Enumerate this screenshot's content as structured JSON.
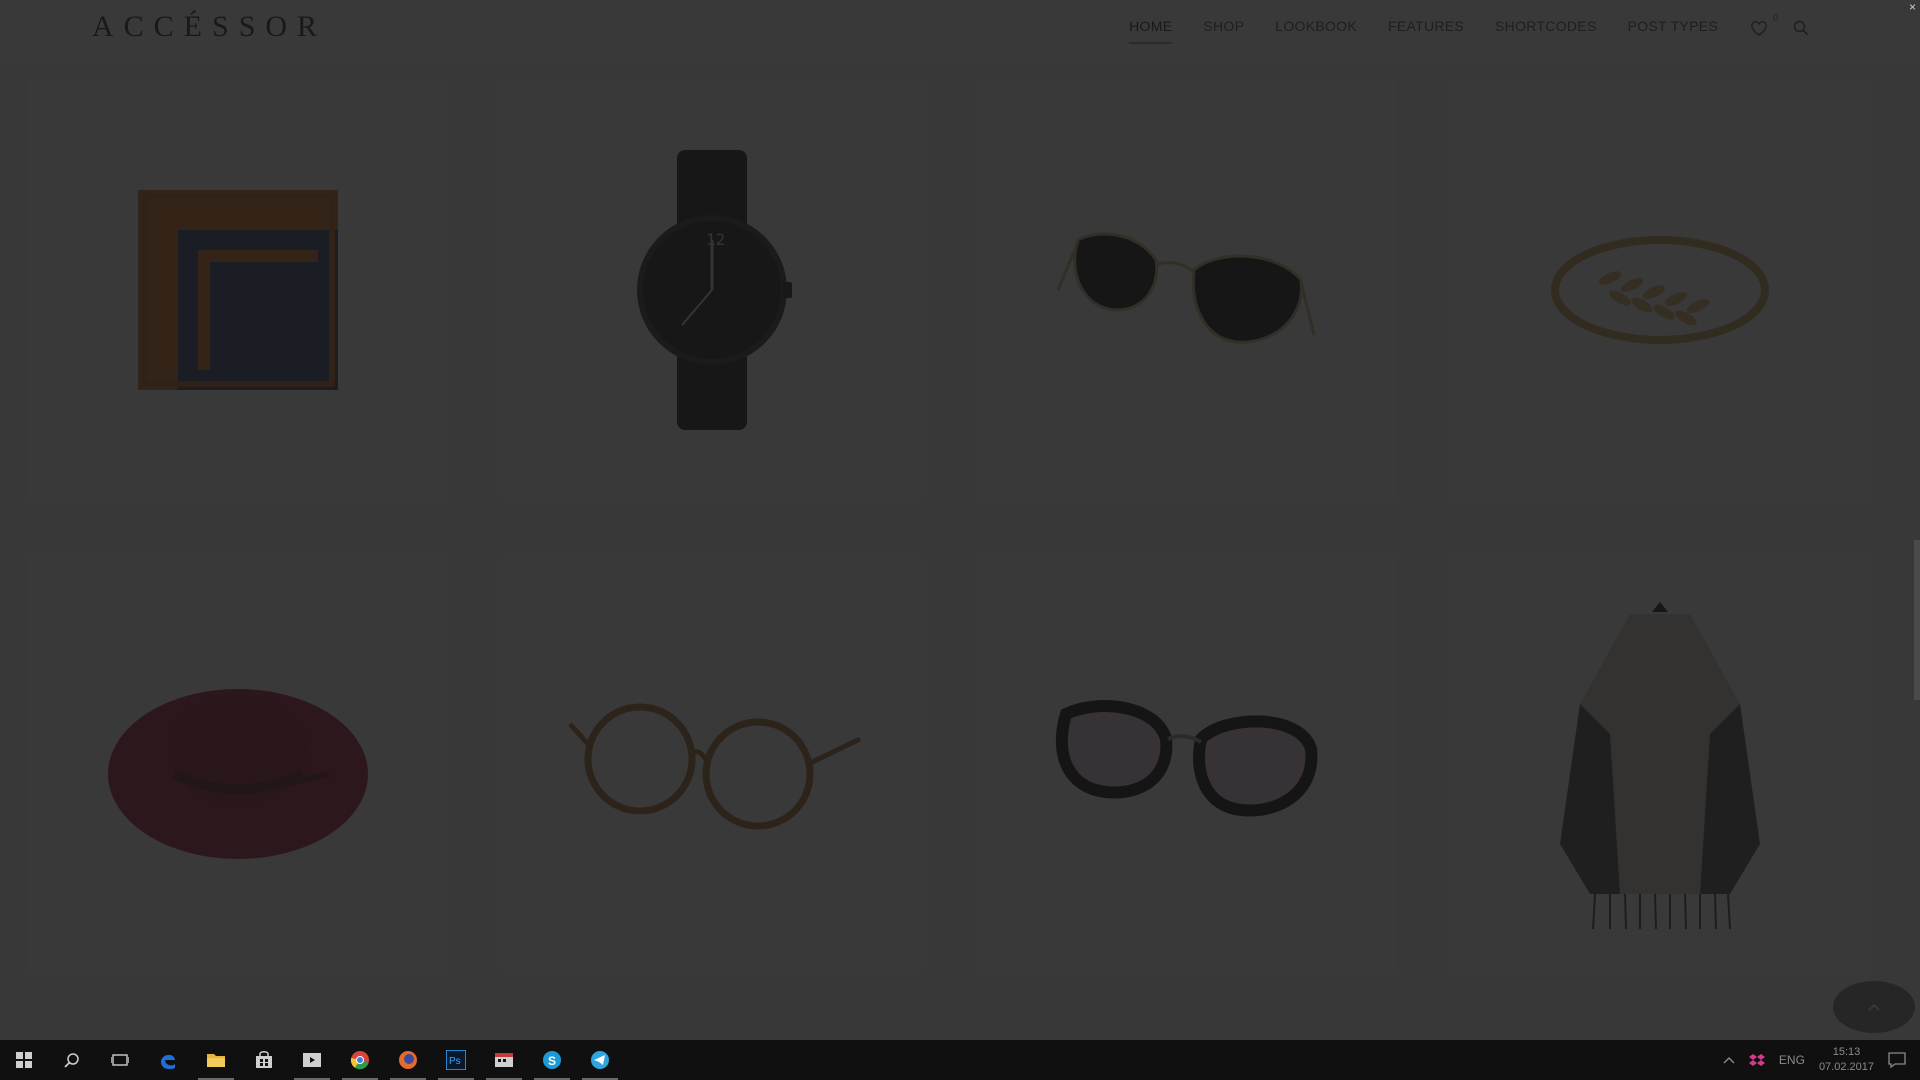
{
  "site": {
    "logo": "ACCÉSSOR",
    "nav": [
      {
        "label": "HOME",
        "active": true
      },
      {
        "label": "SHOP",
        "active": false
      },
      {
        "label": "LOOKBOOK",
        "active": false
      },
      {
        "label": "FEATURES",
        "active": false
      },
      {
        "label": "SHORTCODES",
        "active": false
      },
      {
        "label": "POST TYPES",
        "active": false
      }
    ],
    "wishlist_count": "0",
    "icons": [
      "heart-icon",
      "search-icon"
    ]
  },
  "products": [
    {
      "name": "pocket-square",
      "icon": "scarf-image"
    },
    {
      "name": "watch",
      "icon": "watch-image"
    },
    {
      "name": "cat-eye-sunglasses",
      "icon": "sunglasses-image"
    },
    {
      "name": "leaf-bracelet",
      "icon": "bracelet-image"
    },
    {
      "name": "wide-brim-hat",
      "icon": "hat-image"
    },
    {
      "name": "round-glasses",
      "icon": "glasses-image"
    },
    {
      "name": "black-sunglasses",
      "icon": "sunglasses-image"
    },
    {
      "name": "fringe-poncho",
      "icon": "poncho-image"
    }
  ],
  "overlay": {
    "color": "#181818",
    "close_glyph": "×"
  },
  "scroll_top_icon": "chevron-up-icon",
  "taskbar": {
    "apps": [
      "windows-start-icon",
      "search-icon",
      "task-view-icon",
      "edge-icon",
      "file-explorer-icon",
      "store-icon",
      "media-player-icon",
      "chrome-icon",
      "firefox-icon",
      "photoshop-icon",
      "calendar-app-icon",
      "skype-icon",
      "telegram-icon"
    ],
    "tray": {
      "language": "ENG",
      "time": "15:13",
      "date": "07.02.2017"
    }
  }
}
